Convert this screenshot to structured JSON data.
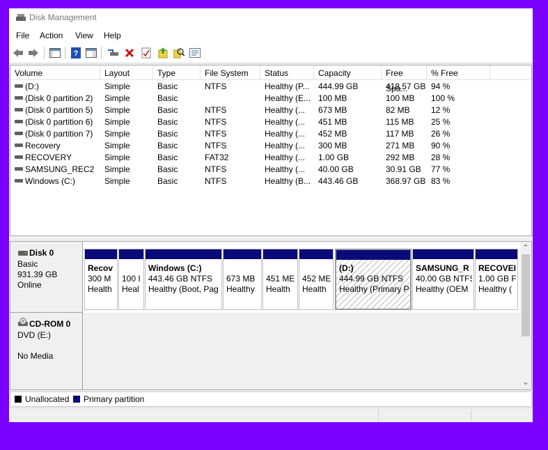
{
  "window": {
    "title": "Disk Management"
  },
  "menu": [
    "File",
    "Action",
    "View",
    "Help"
  ],
  "toolbar_icons": [
    "back-arrow-icon",
    "forward-arrow-icon",
    "console-tree-icon",
    "help-icon",
    "action-pane-icon",
    "connect-disk-icon",
    "delete-icon",
    "properties-icon",
    "refresh-up-icon",
    "search-icon",
    "list-view-icon"
  ],
  "volumes": {
    "columns": [
      "Volume",
      "Layout",
      "Type",
      "File System",
      "Status",
      "Capacity",
      "Free Spa...",
      "% Free"
    ],
    "rows": [
      [
        "(D:)",
        "Simple",
        "Basic",
        "NTFS",
        "Healthy (P...",
        "444.99 GB",
        "418.57 GB",
        "94 %"
      ],
      [
        "(Disk 0 partition 2)",
        "Simple",
        "Basic",
        "",
        "Healthy (E...",
        "100 MB",
        "100 MB",
        "100 %"
      ],
      [
        "(Disk 0 partition 5)",
        "Simple",
        "Basic",
        "NTFS",
        "Healthy (...",
        "673 MB",
        "82 MB",
        "12 %"
      ],
      [
        "(Disk 0 partition 6)",
        "Simple",
        "Basic",
        "NTFS",
        "Healthy (...",
        "451 MB",
        "115 MB",
        "25 %"
      ],
      [
        "(Disk 0 partition 7)",
        "Simple",
        "Basic",
        "NTFS",
        "Healthy (...",
        "452 MB",
        "117 MB",
        "26 %"
      ],
      [
        "Recovery",
        "Simple",
        "Basic",
        "NTFS",
        "Healthy (...",
        "300 MB",
        "271 MB",
        "90 %"
      ],
      [
        "RECOVERY",
        "Simple",
        "Basic",
        "FAT32",
        "Healthy (...",
        "1.00 GB",
        "292 MB",
        "28 %"
      ],
      [
        "SAMSUNG_REC2",
        "Simple",
        "Basic",
        "NTFS",
        "Healthy (...",
        "40.00 GB",
        "30.91 GB",
        "77 %"
      ],
      [
        "Windows (C:)",
        "Simple",
        "Basic",
        "NTFS",
        "Healthy (B...",
        "443.46 GB",
        "368.97 GB",
        "83 %"
      ]
    ]
  },
  "disk0": {
    "name": "Disk 0",
    "kind": "Basic",
    "size": "931.39 GB",
    "state": "Online",
    "partitions": [
      {
        "l1": "Recov",
        "l2": "300 M",
        "l3": "Health"
      },
      {
        "l1": "",
        "l2": "100 I",
        "l3": "Heal"
      },
      {
        "l1": "Windows  (C:)",
        "l2": "443.46 GB NTFS",
        "l3": "Healthy (Boot, Pag"
      },
      {
        "l1": "",
        "l2": "673 MB",
        "l3": "Healthy"
      },
      {
        "l1": "",
        "l2": "451 ME",
        "l3": "Health"
      },
      {
        "l1": "",
        "l2": "452 ME",
        "l3": "Health"
      },
      {
        "l1": "(D:)",
        "l2": "444.99 GB NTFS",
        "l3": "Healthy (Primary P"
      },
      {
        "l1": "SAMSUNG_R",
        "l2": "40.00 GB NTFS",
        "l3": "Healthy (OEM"
      },
      {
        "l1": "RECOVEI",
        "l2": "1.00 GB F",
        "l3": "Healthy ("
      }
    ]
  },
  "cdrom": {
    "name": "CD-ROM 0",
    "drive": "DVD (E:)",
    "state": "No Media"
  },
  "legend": [
    {
      "label": "Unallocated",
      "color": "#000000"
    },
    {
      "label": "Primary partition",
      "color": "#0a0a78"
    }
  ],
  "scroll": {
    "up": "⌃",
    "down": "⌄"
  }
}
